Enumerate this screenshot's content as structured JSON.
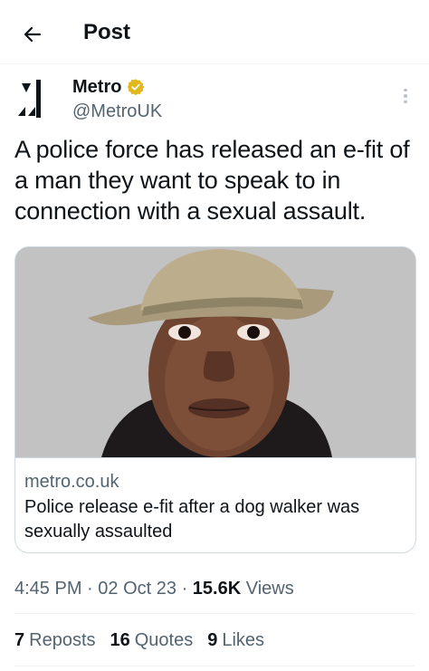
{
  "header": {
    "title": "Post",
    "back_icon": "arrow-left-icon"
  },
  "author": {
    "display_name": "Metro",
    "handle": "@MetroUK",
    "verified_icon": "verified-badge-icon",
    "verified_color": "#e2b719",
    "avatar_icon": "metro-logo-icon",
    "more_icon": "more-vertical-icon"
  },
  "post": {
    "text": "A police force has released an e-fit of a man they want to speak to in connection with a sexual assault."
  },
  "link_card": {
    "image_icon": "efit-portrait-image",
    "domain": "metro.co.uk",
    "title": "Police release e-fit after a dog walker was sexually assaulted"
  },
  "meta": {
    "time": "4:45 PM",
    "separator": "·",
    "date": "02 Oct 23",
    "views_count": "15.6K",
    "views_label": "Views"
  },
  "stats": {
    "reposts_count": "7",
    "reposts_label": "Reposts",
    "quotes_count": "16",
    "quotes_label": "Quotes",
    "likes_count": "9",
    "likes_label": "Likes"
  },
  "colors": {
    "text": "#0f1419",
    "secondary": "#536471",
    "border": "#cfd9de"
  }
}
